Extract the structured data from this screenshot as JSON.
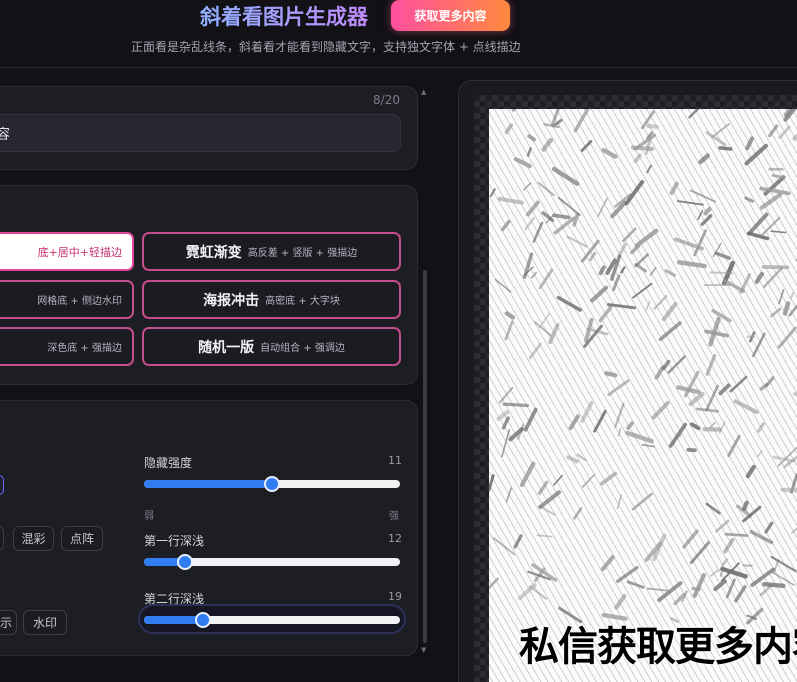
{
  "header": {
    "title": "斜着看图片生成器",
    "cta_button": "获取更多内容",
    "subtitle": "正面看是杂乱线条，斜着看才能看到隐藏文字，支持独文字体 + 点线描边"
  },
  "text_card": {
    "char_count": "8/20",
    "input_value": "容"
  },
  "presets": [
    {
      "name": "",
      "desc": "底+居中+轻描边",
      "active": true
    },
    {
      "name": "霓虹渐变",
      "desc": "高反差 + 竖版 + 强描边",
      "active": false
    },
    {
      "name": "",
      "desc": "网格底 + 侧边水印",
      "active": false
    },
    {
      "name": "海报冲击",
      "desc": "高密底 + 大字块",
      "active": false
    },
    {
      "name": "",
      "desc": "深色底 + 强描边",
      "active": false
    },
    {
      "name": "随机一版",
      "desc": "自动组合 + 强调边",
      "active": false
    }
  ],
  "style_chips": [
    "混彩",
    "点阵"
  ],
  "bottom_chips": [
    "示",
    "水印"
  ],
  "sliders": [
    {
      "label": "隐藏强度",
      "value": "11",
      "ratio": 0.5,
      "min_label": "弱",
      "max_label": "强"
    },
    {
      "label": "第一行深浅",
      "value": "12",
      "ratio": 0.16
    },
    {
      "label": "第二行深浅",
      "value": "19",
      "ratio": 0.23
    }
  ],
  "preview": {
    "watermark": "私信获取更多内容"
  },
  "colors": {
    "accent_blue": "#2f7df1",
    "preset_border": "#c44e8e",
    "cta_gradient_start": "#ff4fa0",
    "cta_gradient_end": "#ff8a3d"
  }
}
